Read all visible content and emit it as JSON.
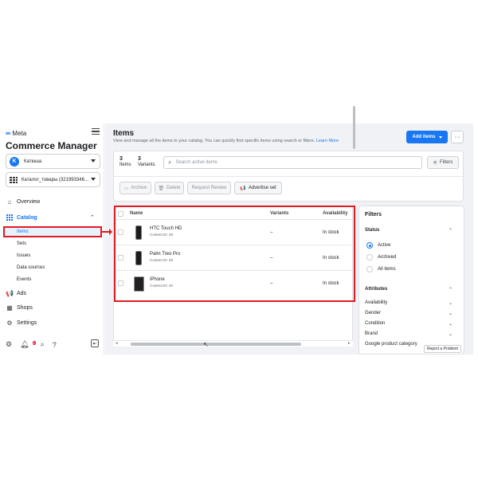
{
  "brand": {
    "logo": "∞",
    "name": "Meta"
  },
  "sidebar": {
    "title": "Commerce Manager",
    "account": {
      "initial": "K",
      "name": "Катюша"
    },
    "catalog_select": "Каталог_товары (321993346...",
    "nav": {
      "overview": "Overview",
      "catalog": "Catalog",
      "items": "Items",
      "sets": "Sets",
      "issues": "Issues",
      "data_sources": "Data sources",
      "events": "Events",
      "ads": "Ads",
      "shops": "Shops",
      "settings": "Settings"
    },
    "notif_badge": "8"
  },
  "header": {
    "title": "Items",
    "subtitle": "View and manage all the items in your catalog. You can quickly find specific items using search or filters.",
    "learn_more": "Learn More",
    "add_items": "Add items",
    "more": "···"
  },
  "summary": {
    "items_count": "3",
    "items_label": "Items",
    "variants_count": "3",
    "variants_label": "Variants",
    "search_placeholder": "Search active items",
    "filters_label": "Filters"
  },
  "toolbar": {
    "archive": "Archive",
    "delete": "Delete",
    "request_review": "Request Review",
    "advertise_set": "Advertise set"
  },
  "table": {
    "columns": [
      "Name",
      "Variants",
      "Availability"
    ],
    "rows": [
      {
        "name": "HTC Touch HD",
        "content_id": "Content ID: 28",
        "variants": "–",
        "availability": "In stock"
      },
      {
        "name": "Palm Treo Pro",
        "content_id": "Content ID: 29",
        "variants": "–",
        "availability": "In stock"
      },
      {
        "name": "iPhone",
        "content_id": "Content ID: 40",
        "variants": "–",
        "availability": "In stock"
      }
    ]
  },
  "filters": {
    "title": "Filters",
    "status_label": "Status",
    "status_options": [
      "Active",
      "Archived",
      "All items"
    ],
    "status_selected": "Active",
    "attributes_label": "Attributes",
    "attributes": [
      "Availability",
      "Gender",
      "Condition",
      "Brand",
      "Google product category"
    ]
  },
  "report_problem": "Report a Problem",
  "colors": {
    "accent": "#1877f2",
    "highlight": "#e11b22"
  },
  "icons": [
    "menu-icon",
    "overview-icon",
    "catalog-icon",
    "megaphone-icon",
    "shop-icon",
    "gear-icon",
    "bell-icon",
    "search-icon",
    "help-icon",
    "filter-sliders-icon",
    "archive-icon",
    "trash-icon"
  ]
}
